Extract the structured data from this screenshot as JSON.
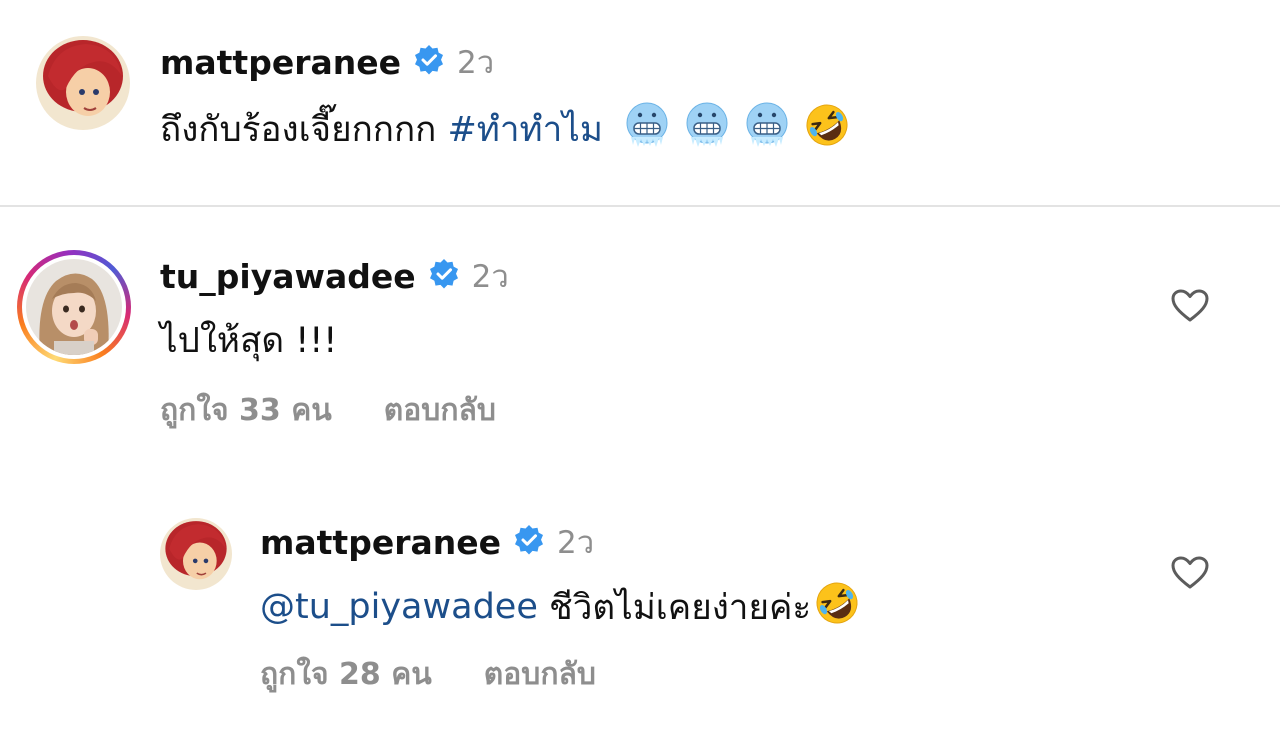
{
  "comments": [
    {
      "username": "mattperanee",
      "time": "2ว",
      "text_prefix": "ถึงกับร้องเจี๊ยกกกก ",
      "hashtag": "#ทำทำไม",
      "emojis": [
        "cold-face",
        "cold-face",
        "cold-face",
        "rofl"
      ]
    },
    {
      "username": "tu_piyawadee",
      "time": "2ว",
      "text": "ไปให้สุด !!!",
      "likes": "ถูกใจ 33 คน",
      "reply": "ตอบกลับ"
    },
    {
      "username": "mattperanee",
      "time": "2ว",
      "mention": "@tu_piyawadee",
      "text": " ชีวิตไม่เคยง่ายค่ะ",
      "emoji": "rofl",
      "likes": "ถูกใจ 28 คน",
      "reply": "ตอบกลับ"
    }
  ],
  "colors": {
    "verified": "#3897f0",
    "link": "#1c4e8a",
    "muted": "#8e8e8e",
    "divider": "#e3e3e3"
  },
  "icons": {
    "verified": "verified-badge-icon",
    "like": "heart-outline-icon"
  }
}
